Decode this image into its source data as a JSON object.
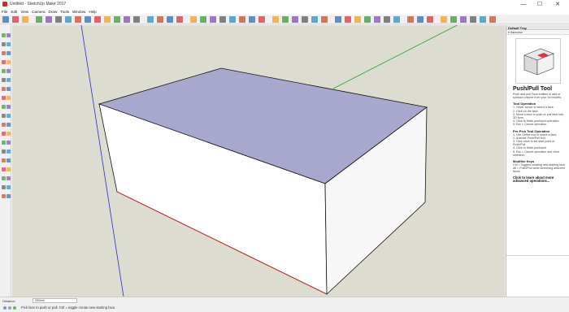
{
  "window": {
    "title": "Untitled - SketchUp Make 2017",
    "minimize": "—",
    "maximize": "☐",
    "close": "✕"
  },
  "menu": [
    "File",
    "Edit",
    "View",
    "Camera",
    "Draw",
    "Tools",
    "Window",
    "Help"
  ],
  "toolbar_icons": [
    "select-tool",
    "eraser-tool",
    "paint-bucket-tool",
    "new-file",
    "open-file",
    "save-file",
    "cut",
    "copy",
    "paste",
    "erase",
    "undo",
    "redo",
    "print",
    "model-info",
    "3d-warehouse",
    "share-model",
    "extension-warehouse",
    "layout",
    "move",
    "rotate",
    "scale",
    "push-pull",
    "orbit",
    "pan",
    "zoom",
    "zoom-extents",
    "iso-view",
    "top-view",
    "front-view",
    "right-view",
    "back-view",
    "left-view",
    "xray",
    "back-edges",
    "wireframe",
    "hidden-line",
    "shaded",
    "shaded-textures",
    "monochrome",
    "section-plane",
    "display-section-planes",
    "display-section-cuts",
    "tape-measure",
    "dimension",
    "protractor",
    "text",
    "axes",
    "3d-text"
  ],
  "tray": {
    "title": "Default Tray",
    "subsection": "▾ Instructor",
    "tool_name": "Push/Pull Tool",
    "tool_desc": "Push and pull Face entities to add or subtract volume from your 3d models.",
    "sections": [
      {
        "heading": "Tool Operation",
        "steps": [
          "1. Hover cursor to select a face.",
          "2. Click on the face.",
          "3. Move cursor to push or pull face into 3D form.",
          "4. Click to finish push/pull operation.",
          "5. Esc = Cancel operation."
        ]
      },
      {
        "heading": "Pre-Pick Tool Operation",
        "steps": [
          "1. Use Select tool to select a face.",
          "2. Activate Push/Pull tool.",
          "3. Click once to set start point of Push/Pull.",
          "4. Click to finish push/pull.",
          "5. Esc = Cancel operation and clear selection."
        ]
      },
      {
        "heading": "Modifier Keys",
        "steps": [
          "Ctrl = Toggles creating new starting face.",
          "Alt = Push/Pull while stretching attached faces."
        ]
      }
    ],
    "learn_more": "Click to learn about more advanced operations..."
  },
  "status": {
    "measure_label": "Distance",
    "measure_value": "200mm",
    "hint": "Pick face to push or pull.  Ctrl = toggle create new starting face."
  },
  "colors": {
    "viewport_bg": "#dcdcd0",
    "top_face": "#a8a8cf",
    "front_face": "#ffffff",
    "side_face": "#f5f5f5",
    "axis_red": "#cc2020",
    "axis_green": "#25a225",
    "axis_blue": "#2a2ad8"
  }
}
